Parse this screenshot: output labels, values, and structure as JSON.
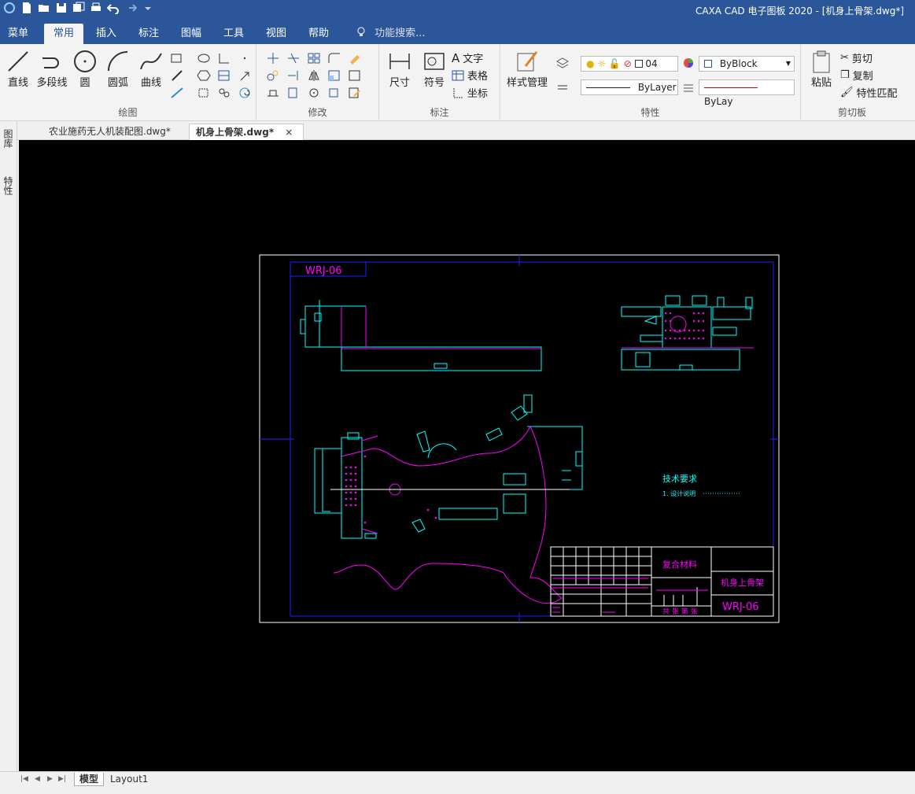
{
  "app": {
    "title": "CAXA CAD 电子图板 2020 - [机身上骨架.dwg*]"
  },
  "menu": {
    "tabs": [
      {
        "label": "菜单"
      },
      {
        "label": "常用"
      },
      {
        "label": "插入"
      },
      {
        "label": "标注"
      },
      {
        "label": "图幅"
      },
      {
        "label": "工具"
      },
      {
        "label": "视图"
      },
      {
        "label": "帮助"
      }
    ],
    "active": "常用",
    "search_label": "功能搜索..."
  },
  "ribbon": {
    "draw": {
      "label": "绘图",
      "line": "直线",
      "polyline": "多段线",
      "circle": "圆",
      "arc": "圆弧",
      "curve": "曲线"
    },
    "modify": {
      "label": "修改"
    },
    "annotate": {
      "label": "标注",
      "dimension": "尺寸",
      "symbol": "符号",
      "text": "文字",
      "table": "表格",
      "coordinate": "坐标"
    },
    "properties": {
      "label": "特性",
      "style_manager": "样式管理",
      "layer_value": "04",
      "color_value": "ByBlock",
      "linetype_value": "ByLayer",
      "lineweight_value": "ByLay"
    },
    "clipboard": {
      "label": "剪切板",
      "paste": "粘贴",
      "cut": "剪切",
      "copy": "复制",
      "match": "特性匹配"
    }
  },
  "documents": {
    "tabs": [
      {
        "label": "农业施药无人机装配图.dwg*"
      },
      {
        "label": "机身上骨架.dwg*"
      }
    ],
    "close_label": "×"
  },
  "side_panel": {
    "library": "图库",
    "properties": "特性"
  },
  "drawing": {
    "code_top": "WRJ-06",
    "tech_title": "技术要求",
    "tech_item": "1. 设计说明",
    "material": "复合材料",
    "part_name": "机身上骨架",
    "code_bottom": "WRJ-06",
    "sheet_text": "共  张  第  张",
    "colors": {
      "frame": "#ffffff",
      "border": "#0000ff",
      "cyan": "#00ffff",
      "magenta": "#ff00ff"
    }
  },
  "layouts": {
    "tabs": [
      {
        "label": "模型"
      },
      {
        "label": "Layout1"
      }
    ]
  }
}
